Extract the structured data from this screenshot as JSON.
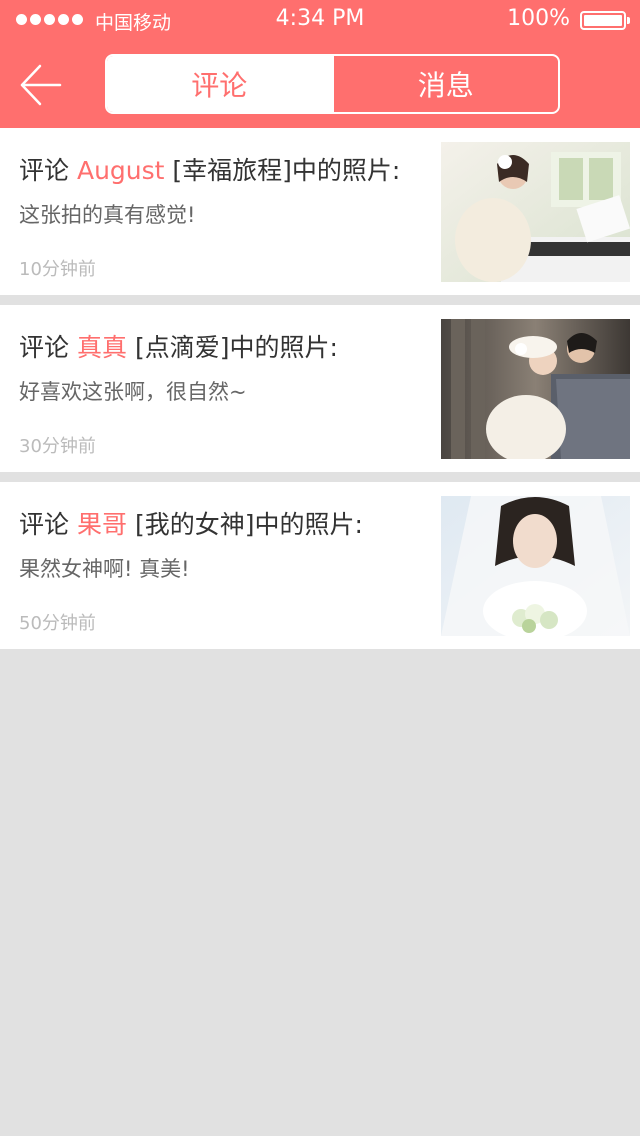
{
  "status_bar": {
    "carrier": "中国移动",
    "time": "4:34 PM",
    "battery": "100%"
  },
  "nav": {
    "tabs": [
      {
        "label": "评论",
        "active": true
      },
      {
        "label": "消息",
        "active": false
      }
    ]
  },
  "comments": [
    {
      "prefix": "评论",
      "user": "August",
      "album_title": "[幸福旅程]中的照片:",
      "text": "这张拍的真有感觉!",
      "time": "10分钟前"
    },
    {
      "prefix": "评论",
      "user": "真真",
      "album_title": "[点滴爱]中的照片:",
      "text": "好喜欢这张啊，很自然~",
      "time": "30分钟前"
    },
    {
      "prefix": "评论",
      "user": "果哥",
      "album_title": "[我的女神]中的照片:",
      "text": "果然女神啊! 真美!",
      "time": "50分钟前"
    }
  ],
  "colors": {
    "accent": "#ff6f6e",
    "background": "#e1e1e1"
  }
}
